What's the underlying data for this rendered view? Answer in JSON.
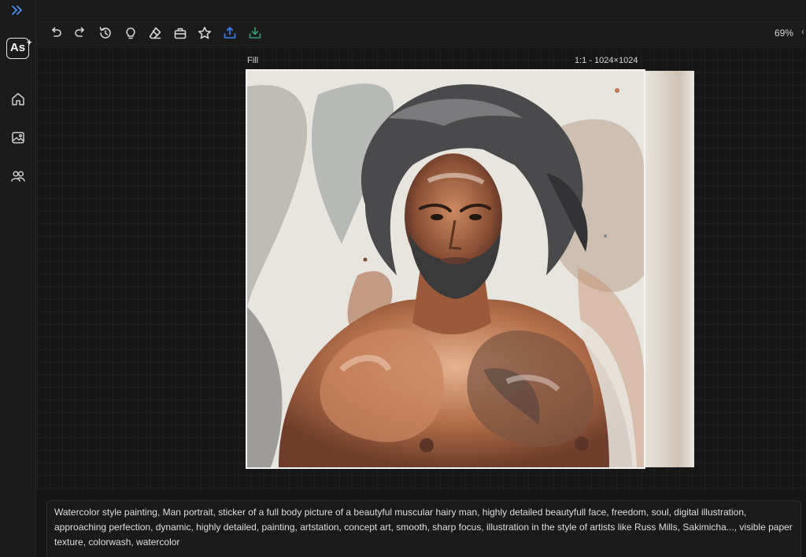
{
  "sidebar": {
    "logo_text": "As",
    "icons": [
      "expand-icon",
      "home-icon",
      "gallery-icon",
      "community-icon"
    ]
  },
  "toolbar": {
    "tools": [
      "undo-icon",
      "redo-icon",
      "history-icon",
      "lightbulb-icon",
      "eraser-icon",
      "toolbox-icon",
      "star-icon",
      "upload-icon",
      "download-icon"
    ],
    "zoom": "69%",
    "accent_color": "#3b82f6",
    "download_color": "#2f9e6b"
  },
  "canvas": {
    "fill_label": "Fill",
    "size_label": "1:1 - 1024×1024"
  },
  "prompt": {
    "text": "Watercolor style painting, Man portrait, sticker of a full body picture of a beautyful muscular hairy man, highly detailed beautyfull face, freedom, soul, digital illustration, approaching perfection, dynamic, highly detailed, painting, artstation, concept art, smooth, sharp focus, illustration in the style of artists like Russ Mills, Sakimicha..., visible paper texture, colorwash, watercolor"
  }
}
